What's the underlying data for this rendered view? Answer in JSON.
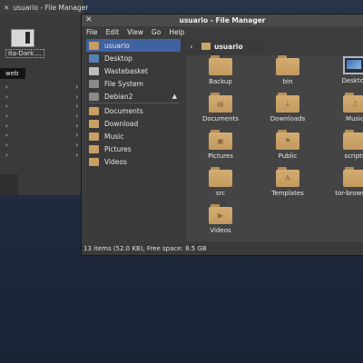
{
  "background_window": {
    "title": "usuario - File Manager",
    "close_icon": "close-icon",
    "theme_label": "ita-Dark....",
    "selected_text": "web",
    "arrow_count": 8
  },
  "window": {
    "title": "usuario - File Manager",
    "menu": [
      "File",
      "Edit",
      "View",
      "Go",
      "Help"
    ],
    "path": {
      "current": "usuario"
    },
    "status": "13 items (52.0 KB), Free space: 8.5 GB"
  },
  "sidebar": {
    "items": [
      {
        "label": "usuario",
        "icon": "home-icon",
        "active": true
      },
      {
        "label": "Desktop",
        "icon": "desktop-icon"
      },
      {
        "label": "Wastebasket",
        "icon": "trash-icon"
      },
      {
        "label": "File System",
        "icon": "drive-icon"
      },
      {
        "label": "Debian2",
        "icon": "drive-icon",
        "eject": "▲"
      },
      {
        "label": "Documents",
        "icon": "folder-icon"
      },
      {
        "label": "Download",
        "icon": "folder-icon"
      },
      {
        "label": "Music",
        "icon": "folder-icon"
      },
      {
        "label": "Pictures",
        "icon": "folder-icon"
      },
      {
        "label": "Videos",
        "icon": "folder-icon"
      }
    ]
  },
  "files": [
    {
      "label": "Backup",
      "type": "folder"
    },
    {
      "label": "bin",
      "type": "folder"
    },
    {
      "label": "Desktop",
      "type": "desktop"
    },
    {
      "label": "Documents",
      "type": "folder",
      "glyph": "▤"
    },
    {
      "label": "Downloads",
      "type": "folder",
      "glyph": "↓"
    },
    {
      "label": "Music",
      "type": "folder",
      "glyph": "♫"
    },
    {
      "label": "Pictures",
      "type": "folder",
      "glyph": "▣"
    },
    {
      "label": "Public",
      "type": "folder",
      "glyph": "⚑"
    },
    {
      "label": "scripts",
      "type": "folder"
    },
    {
      "label": "src",
      "type": "folder"
    },
    {
      "label": "Templates",
      "type": "folder",
      "glyph": "A"
    },
    {
      "label": "tor-browser_",
      "type": "folder"
    },
    {
      "label": "Videos",
      "type": "folder",
      "glyph": "▶"
    }
  ],
  "colors": {
    "accent": "#3f62a0",
    "folder": "#caa56a",
    "window_bg": "#3c3c3c",
    "desktop_bg": "#27344a"
  }
}
